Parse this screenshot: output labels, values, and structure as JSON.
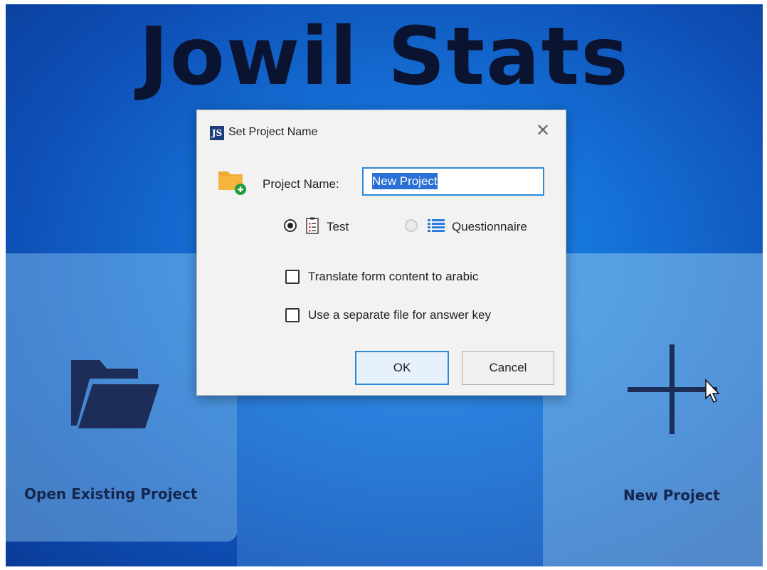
{
  "app": {
    "title": "Jowil Stats"
  },
  "tiles": {
    "open_label": "Open Existing Project",
    "new_label": "New Project"
  },
  "dialog": {
    "icon_text": "JS",
    "title": "Set Project Name",
    "close_glyph": "✕",
    "project_name_label": "Project Name:",
    "project_name_value": "New Project",
    "type_options": [
      {
        "label": "Test",
        "selected": true,
        "icon": "test-sheet-icon"
      },
      {
        "label": "Questionnaire",
        "selected": false,
        "icon": "list-icon"
      }
    ],
    "checkboxes": [
      {
        "label": "Translate form content to arabic",
        "checked": false
      },
      {
        "label": "Use a separate file for answer key",
        "checked": false
      }
    ],
    "ok_label": "OK",
    "cancel_label": "Cancel"
  },
  "icons": {
    "open_tile": "folder-open-icon",
    "new_tile": "plus-icon",
    "dialog_folder": "folder-add-icon"
  },
  "colors": {
    "background": "#1570d6",
    "selection": "#2a6fd3",
    "focus_border": "#2b8ad8",
    "folder": "#f0a830",
    "add_badge": "#1e9c3a"
  }
}
